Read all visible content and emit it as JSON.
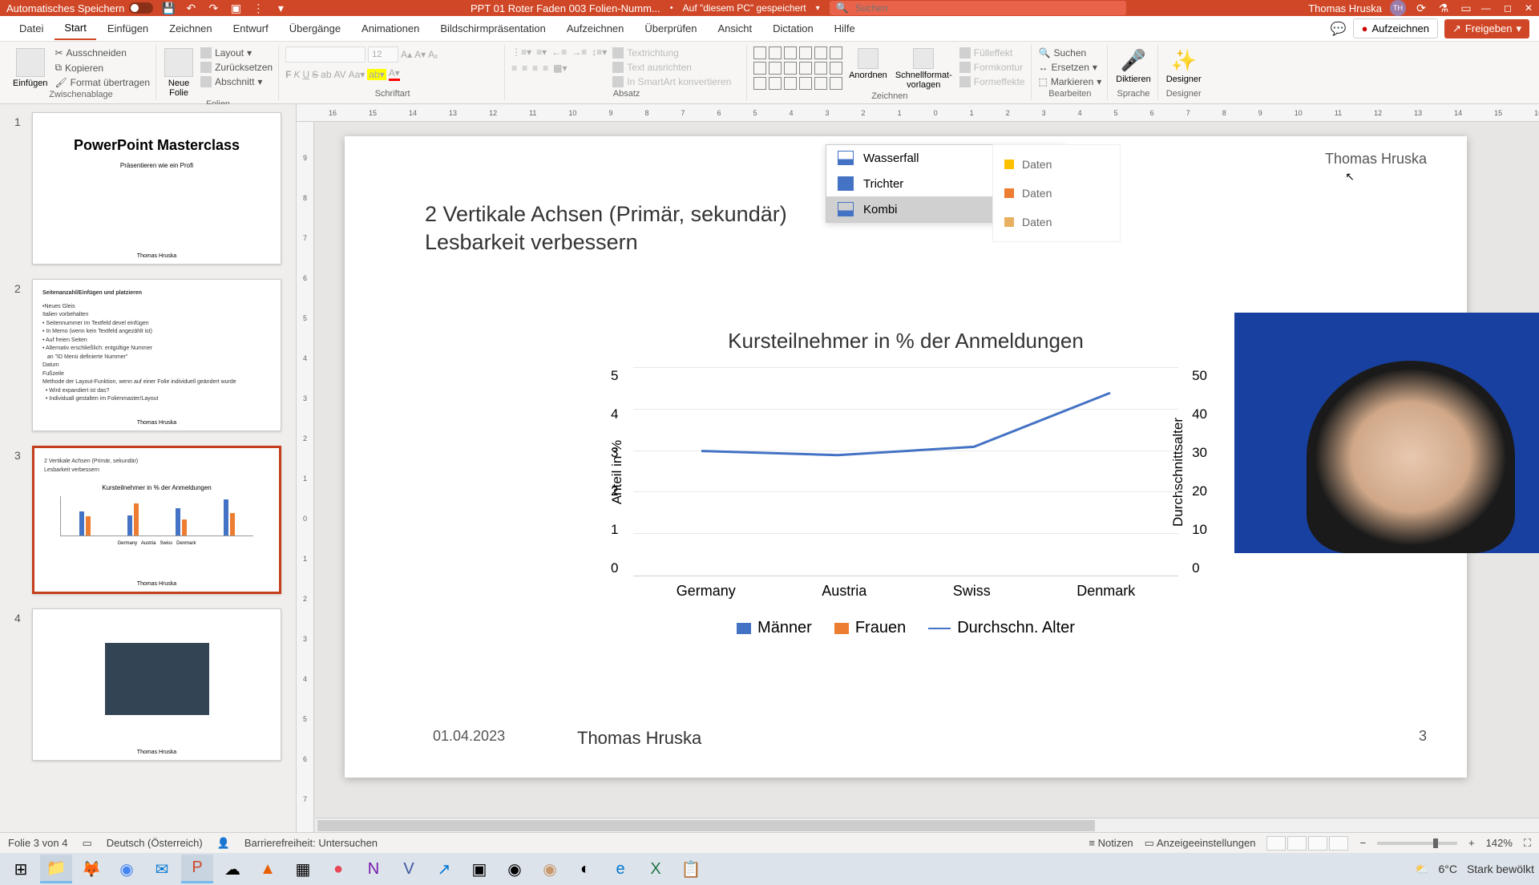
{
  "titlebar": {
    "autosave": "Automatisches Speichern",
    "filename": "PPT 01 Roter Faden 003 Folien-Numm...",
    "saved": "Auf \"diesem PC\" gespeichert",
    "search_placeholder": "Suchen",
    "user": "Thomas Hruska",
    "user_initials": "TH"
  },
  "menubar": [
    "Datei",
    "Start",
    "Einfügen",
    "Zeichnen",
    "Entwurf",
    "Übergänge",
    "Animationen",
    "Bildschirmpräsentation",
    "Aufzeichnen",
    "Überprüfen",
    "Ansicht",
    "Dictation",
    "Hilfe"
  ],
  "menubar_active": 1,
  "menubar_right": {
    "record": "Aufzeichnen",
    "share": "Freigeben"
  },
  "ribbon": {
    "clipboard": {
      "label": "Zwischenablage",
      "paste": "Einfügen",
      "cut": "Ausschneiden",
      "copy": "Kopieren",
      "format": "Format übertragen"
    },
    "slides": {
      "label": "Folien",
      "new": "Neue\nFolie",
      "layout": "Layout",
      "reset": "Zurücksetzen",
      "section": "Abschnitt"
    },
    "font": {
      "label": "Schriftart",
      "size": "12"
    },
    "paragraph": {
      "label": "Absatz",
      "textdir": "Textrichtung",
      "align": "Text ausrichten",
      "smartart": "In SmartArt konvertieren"
    },
    "drawing": {
      "label": "Zeichnen",
      "arrange": "Anordnen",
      "quick": "Schnellformat-\nvorlagen",
      "fill": "Fülleffekt",
      "outline": "Formkontur",
      "effects": "Formeffekte"
    },
    "editing": {
      "label": "Bearbeiten",
      "find": "Suchen",
      "replace": "Ersetzen",
      "select": "Markieren"
    },
    "voice": {
      "label": "Sprache",
      "dictate": "Diktieren"
    },
    "designer": {
      "label": "Designer",
      "btn": "Designer"
    }
  },
  "ruler_h": [
    "16",
    "15",
    "14",
    "13",
    "12",
    "11",
    "10",
    "9",
    "8",
    "7",
    "6",
    "5",
    "4",
    "3",
    "2",
    "1",
    "0",
    "1",
    "2",
    "3",
    "4",
    "5",
    "6",
    "7",
    "8",
    "9",
    "10",
    "11",
    "12",
    "13",
    "14",
    "15",
    "16"
  ],
  "ruler_v": [
    "9",
    "8",
    "7",
    "6",
    "5",
    "4",
    "3",
    "2",
    "1",
    "0",
    "1",
    "2",
    "3",
    "4",
    "5",
    "6",
    "7",
    "8",
    "9"
  ],
  "thumbnails": [
    {
      "num": "1",
      "title": "PowerPoint Masterclass",
      "subtitle": "Präsentieren wie ein Profi",
      "author": "Thomas Hruska"
    },
    {
      "num": "2",
      "heading": "Seitenanzahl/Einfügen und platzieren",
      "author": "Thomas Hruska"
    },
    {
      "num": "3",
      "author": "Thomas Hruska"
    },
    {
      "num": "4",
      "author": "Thomas Hruska"
    }
  ],
  "slide": {
    "header_author": "Thomas Hruska",
    "text_line1": "2 Vertikale Achsen (Primär, sekundär)",
    "text_line2": "Lesbarkeit verbessern",
    "chart_types": {
      "wasserfall": "Wasserfall",
      "trichter": "Trichter",
      "kombi": "Kombi"
    },
    "legend_mini": {
      "d1": "Daten",
      "d2": "Daten",
      "d3": "Daten"
    },
    "footer": {
      "date": "01.04.2023",
      "name": "Thomas Hruska",
      "page": "3"
    }
  },
  "chart_data": {
    "type": "bar",
    "title": "Kursteilnehmer in % der Anmeldungen",
    "ylabel_left": "Anteil in %",
    "ylabel_right": "Durchschnittsalter",
    "ylim_left": [
      0,
      5
    ],
    "ylim_right": [
      0,
      50
    ],
    "yticks_left": [
      "5",
      "4",
      "3",
      "2",
      "1",
      "0"
    ],
    "yticks_right": [
      "50",
      "40",
      "30",
      "20",
      "10",
      "0"
    ],
    "categories": [
      "Germany",
      "Austria",
      "Swiss",
      "Denmark"
    ],
    "series": [
      {
        "name": "Männer",
        "values": [
          3.0,
          2.5,
          3.4,
          4.5
        ],
        "color": "#4472c4"
      },
      {
        "name": "Frauen",
        "values": [
          2.4,
          4.0,
          2.0,
          2.8
        ],
        "color": "#ed7d31"
      }
    ],
    "line_series": {
      "name": "Durchschn. Alter",
      "values": [
        30,
        29,
        31,
        44
      ],
      "color": "#4472c4"
    }
  },
  "statusbar": {
    "slide": "Folie 3 von 4",
    "lang": "Deutsch (Österreich)",
    "access": "Barrierefreiheit: Untersuchen",
    "notes": "Notizen",
    "display": "Anzeigeeinstellungen",
    "zoom": "142%"
  },
  "taskbar": {
    "weather_temp": "6°C",
    "weather_desc": "Stark bewölkt"
  }
}
